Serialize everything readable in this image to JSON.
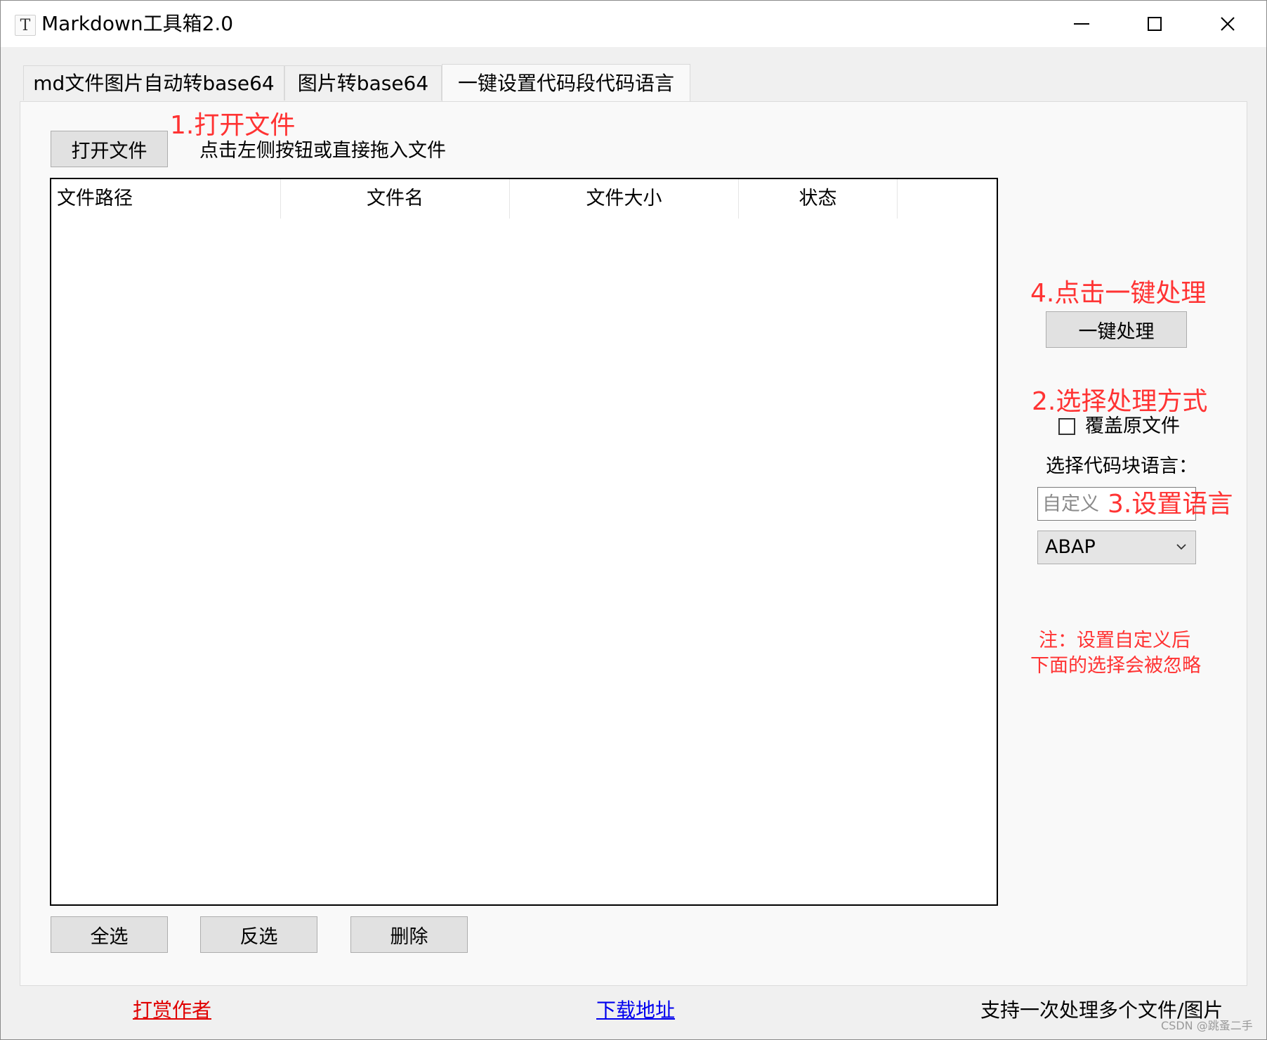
{
  "window": {
    "title": "Markdown工具箱2.0",
    "icon": "T-icon"
  },
  "tabs": [
    {
      "label": "md文件图片自动转base64",
      "active": false
    },
    {
      "label": "图片转base64",
      "active": false
    },
    {
      "label": "一键设置代码段代码语言",
      "active": true
    }
  ],
  "toolbar": {
    "open_button": "打开文件",
    "hint": "点击左侧按钮或直接拖入文件"
  },
  "annotations": {
    "step1": "1.打开文件",
    "step2": "2.选择处理方式",
    "step3": "3.设置语言",
    "step4": "4.点击一键处理",
    "note_line1": "注：设置自定义后",
    "note_line2": "下面的选择会被忽略"
  },
  "table": {
    "columns": [
      "文件路径",
      "文件名",
      "文件大小",
      "状态"
    ],
    "rows": []
  },
  "actions": {
    "select_all": "全选",
    "invert": "反选",
    "delete": "删除",
    "process": "一键处理"
  },
  "options": {
    "overwrite_label": "覆盖原文件",
    "overwrite_checked": false,
    "language_label": "选择代码块语言：",
    "custom_placeholder": "自定义",
    "custom_value": "",
    "language_selected": "ABAP"
  },
  "footer": {
    "donate_link": "打赏作者",
    "download_link": "下载地址",
    "info": "支持一次处理多个文件/图片",
    "watermark": "CSDN @跳蚤二手"
  },
  "colors": {
    "annotation_red": "#ff3333",
    "link_red": "#e00000",
    "link_blue": "#0000ee"
  }
}
